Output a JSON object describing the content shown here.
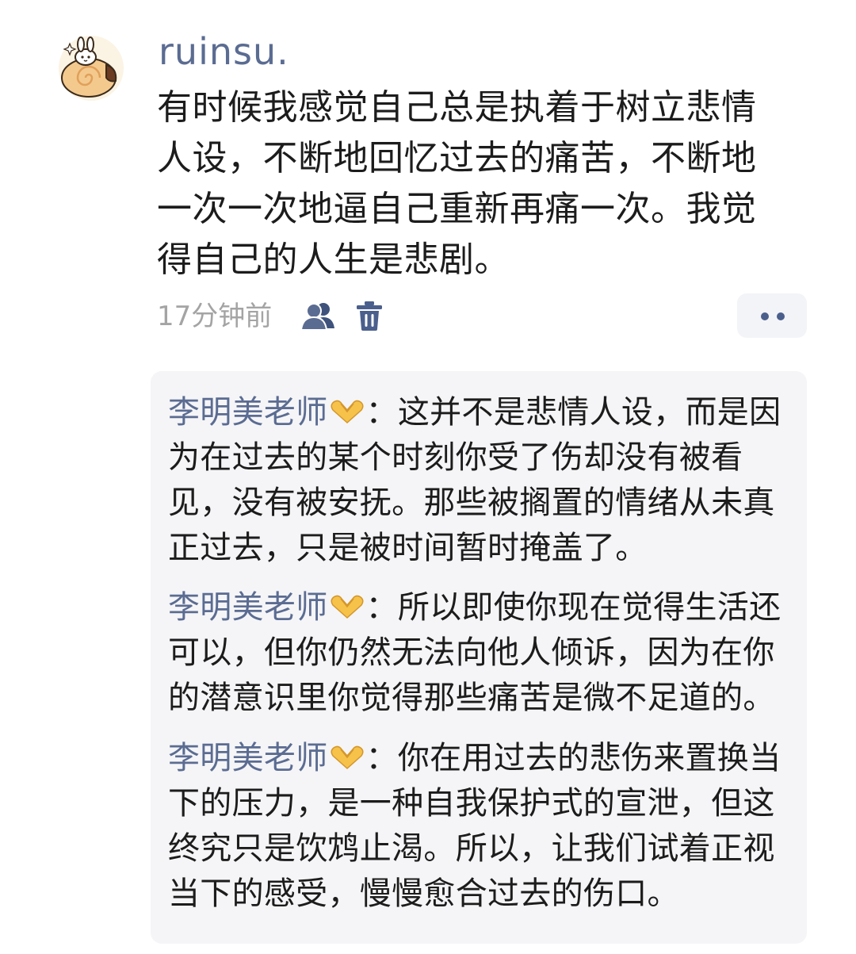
{
  "post": {
    "username": "ruinsu.",
    "text": "有时候我感觉自己总是执着于树立悲情人设，不断地回忆过去的痛苦，不断地一次一次地逼自己重新再痛一次。我觉得自己的人生是悲剧。",
    "timestamp": "17分钟前",
    "icons": {
      "visibility": "users-icon",
      "delete": "trash-icon",
      "more": "more-dots-icon"
    },
    "accent_color": "#5b6c92"
  },
  "replies": [
    {
      "author": "李明美老师",
      "separator": "：",
      "text": "这并不是悲情人设，而是因为在过去的某个时刻你受了伤却没有被看见，没有被安抚。那些被搁置的情绪从未真正过去，只是被时间暂时掩盖了。"
    },
    {
      "author": "李明美老师",
      "separator": "：",
      "text": "所以即使你现在觉得生活还可以，但你仍然无法向他人倾诉，因为在你的潜意识里你觉得那些痛苦是微不足道的。"
    },
    {
      "author": "李明美老师",
      "separator": "：",
      "text": "你在用过去的悲伤来置换当下的压力，是一种自我保护式的宣泄，但这终究只是饮鸩止渴。所以，让我们试着正视当下的感受，慢慢愈合过去的伤口。"
    }
  ]
}
